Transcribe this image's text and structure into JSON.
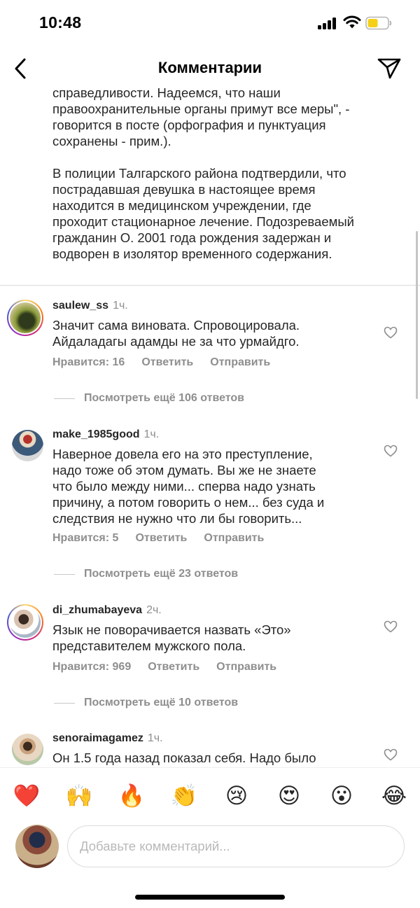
{
  "status_bar": {
    "time": "10:48"
  },
  "header": {
    "title": "Комментарии",
    "back_icon": "chevron-left-icon",
    "send_icon": "paper-plane-icon"
  },
  "caption": {
    "paragraphs": [
      "справедливости. Надеемся, что наши\nправоохранительные органы примут все меры\", -\nговорится в посте (орфография и пунктуация\nсохранены - прим.).",
      "В полиции Талгарского района подтвердили, что\nпострадавшая девушка в настоящее время\nнаходится в медицинском учреждении, где\nпроходит стационарное лечение. Подозреваемый\nгражданин О. 2001 года рождения задержан и\nводворен в изолятор временного содержания."
    ]
  },
  "comments": [
    {
      "username": "saulew_ss",
      "time": "1ч.",
      "text": "Значит сама виновата.  Спровоцировала.\nАйдаладагы адамды не за что урмайдго.",
      "likes": "Нравится: 16",
      "reply": "Ответить",
      "send": "Отправить",
      "view_replies": "Посмотреть ещё 106 ответов"
    },
    {
      "username": "make_1985good",
      "time": "1ч.",
      "text": "Наверное довела его на это преступление,\nнадо тоже об этом думать. Вы же не знаете\nчто было между ними... сперва надо узнать\nпричину, а потом говорить о нем... без суда и\nследствия не нужно что ли бы говорить...",
      "likes": "Нравится: 5",
      "reply": "Ответить",
      "send": "Отправить",
      "view_replies": "Посмотреть ещё 23 ответов"
    },
    {
      "username": "di_zhumabayeva",
      "time": "2ч.",
      "text": "Язык не поворачивается назвать «Это»\nпредставителем мужского пола.",
      "likes": "Нравится: 969",
      "reply": "Ответить",
      "send": "Отправить",
      "view_replies": "Посмотреть ещё 10 ответов"
    },
    {
      "username": "senoraimagamez",
      "time": "1ч.",
      "text": "Он 1.5 года назад показал себя. Надо было"
    }
  ],
  "reactions": [
    "❤️",
    "🙌",
    "🔥",
    "👏",
    "😢",
    "😍",
    "😮",
    "😂"
  ],
  "composer": {
    "placeholder": "Добавьте комментарий..."
  }
}
